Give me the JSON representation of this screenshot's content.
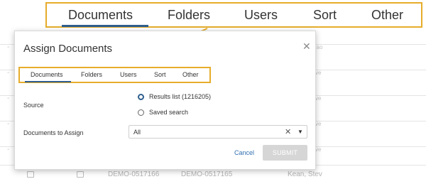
{
  "callout": {
    "tabs": [
      "Documents",
      "Folders",
      "Users",
      "Sort",
      "Other"
    ]
  },
  "dialog": {
    "title": "Assign Documents",
    "tabs": [
      "Documents",
      "Folders",
      "Users",
      "Sort",
      "Other"
    ],
    "active_tab": "Documents",
    "source_label": "Source",
    "source_options": [
      {
        "label": "Results list (1216205)",
        "selected": true
      },
      {
        "label": "Saved search",
        "selected": false
      }
    ],
    "documents_label": "Documents to Assign",
    "documents_value": "All",
    "cancel_label": "Cancel",
    "submit_label": "SUBMIT"
  },
  "background": {
    "row_items": [
      "DEMO-0517166",
      "DEMO-0517165",
      "Kean, Stev"
    ]
  },
  "colors": {
    "highlight": "#e6ad2b",
    "accent": "#2f5e8e",
    "link": "#2f6fb0",
    "disabled_button": "#d6d6d6"
  }
}
